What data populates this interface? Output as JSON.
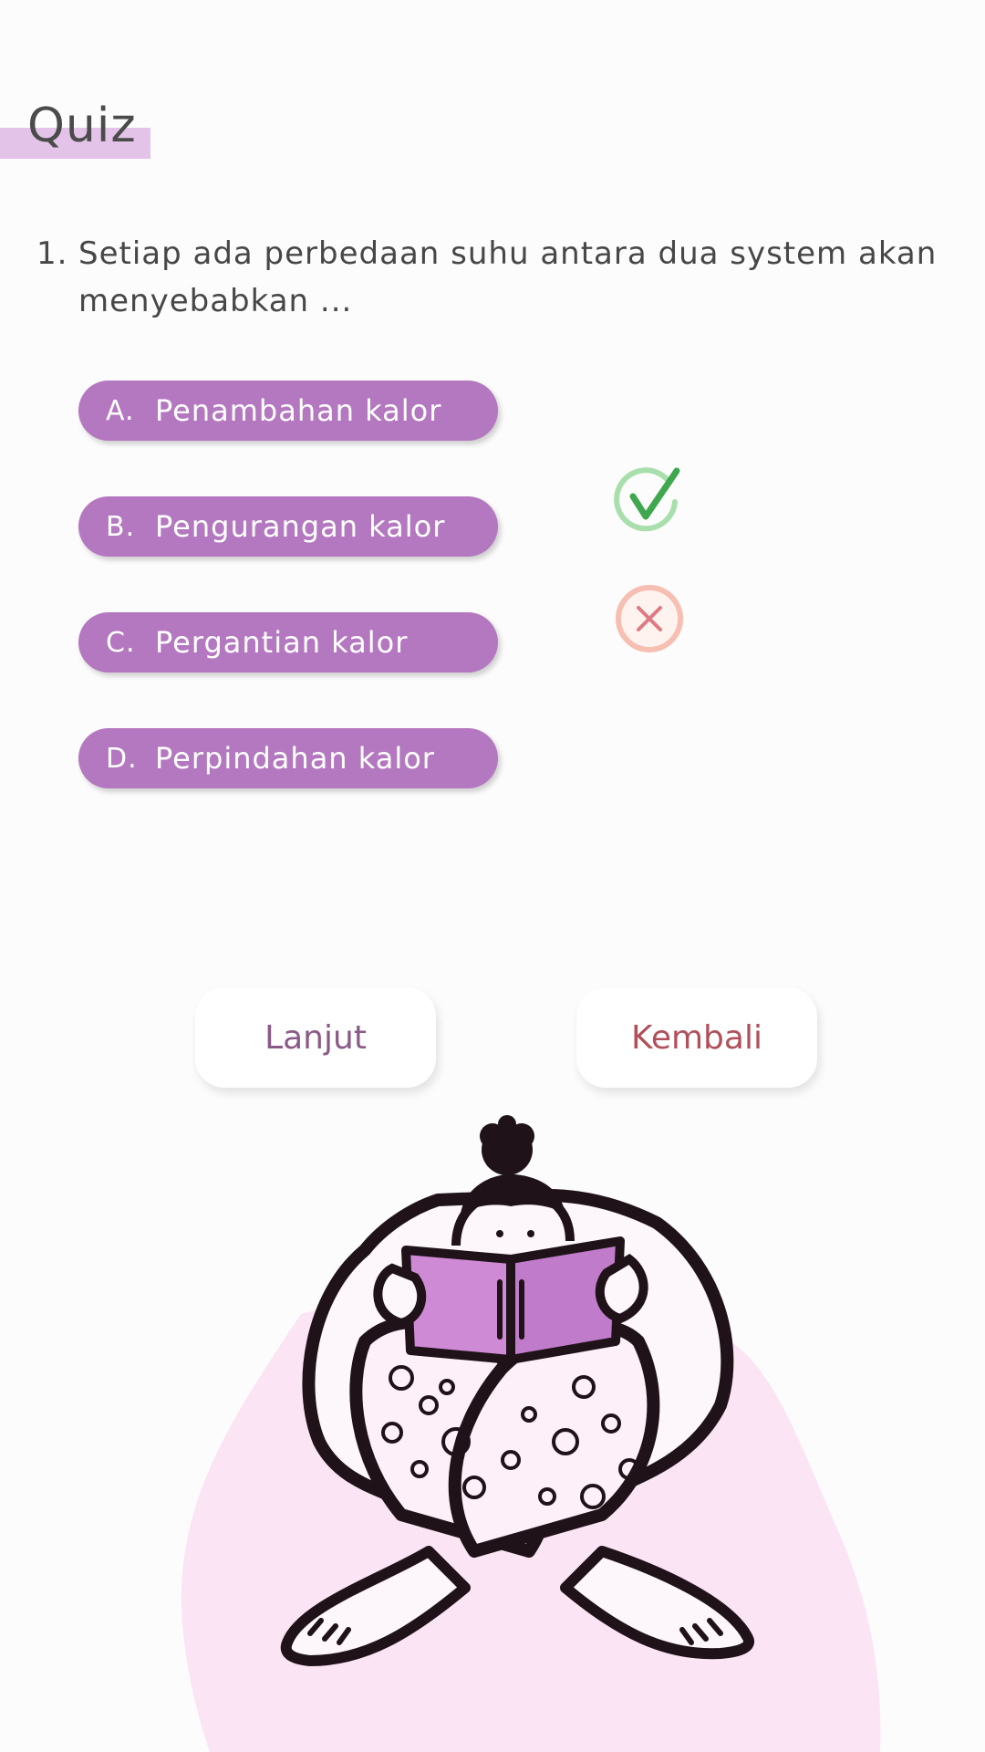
{
  "header": {
    "title": "Quiz"
  },
  "question": {
    "number": "1.",
    "text": "Setiap ada perbedaan suhu antara dua system akan menyebabkan ..."
  },
  "options": [
    {
      "letter": "A.",
      "label": "Penambahan kalor"
    },
    {
      "letter": "B.",
      "label": "Pengurangan kalor"
    },
    {
      "letter": "C.",
      "label": "Pergantian kalor"
    },
    {
      "letter": "D.",
      "label": "Perpindahan kalor"
    }
  ],
  "feedback": {
    "correct_icon": "check-circle-icon",
    "wrong_icon": "close-circle-icon",
    "correct_color": "#5fbf6b",
    "wrong_color": "#f4b6a8"
  },
  "buttons": {
    "next_label": "Lanjut",
    "back_label": "Kembali"
  },
  "colors": {
    "accent": "#b478c0",
    "title_highlight": "#e3c3e7",
    "blob": "#fbe4f4",
    "book": "#cf8ad6"
  },
  "illustration": {
    "icon": "person-reading-book-illustration"
  }
}
